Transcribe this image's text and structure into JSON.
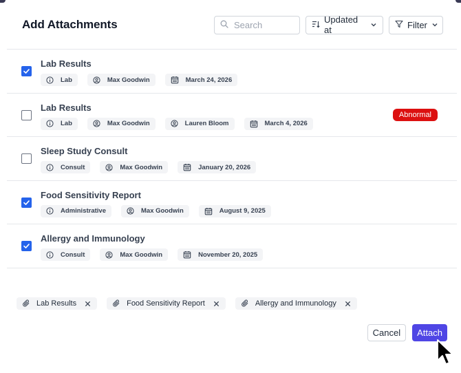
{
  "dialog": {
    "title": "Add Attachments"
  },
  "toolbar": {
    "search_placeholder": "Search",
    "sort_label": "Updated at",
    "filter_label": "Filter"
  },
  "rows": [
    {
      "title": "Lab Results",
      "checked": true,
      "type": "Lab",
      "people": [
        "Max Goodwin"
      ],
      "date": "March 24, 2026",
      "badge": ""
    },
    {
      "title": "Lab Results",
      "checked": false,
      "type": "Lab",
      "people": [
        "Max Goodwin",
        "Lauren Bloom"
      ],
      "date": "March 4, 2026",
      "badge": "Abnormal"
    },
    {
      "title": "Sleep Study Consult",
      "checked": false,
      "type": "Consult",
      "people": [
        "Max Goodwin"
      ],
      "date": "January 20, 2026",
      "badge": ""
    },
    {
      "title": "Food Sensitivity Report",
      "checked": true,
      "type": "Administrative",
      "people": [
        "Max Goodwin"
      ],
      "date": "August 9, 2025",
      "badge": ""
    },
    {
      "title": "Allergy and Immunology",
      "checked": true,
      "type": "Consult",
      "people": [
        "Max Goodwin"
      ],
      "date": "November 20, 2025",
      "badge": ""
    }
  ],
  "selected": [
    "Lab Results",
    "Food Sensitivity Report",
    "Allergy and Immunology"
  ],
  "actions": {
    "cancel_label": "Cancel",
    "attach_label": "Attach"
  },
  "colors": {
    "accent": "#4f46e5",
    "checkbox": "#2563eb",
    "badge": "#dc1010"
  },
  "icons": {
    "info": "info-icon",
    "person": "user-icon",
    "date": "calendar-icon",
    "attachment": "paperclip-icon",
    "remove": "close-icon",
    "search": "search-icon",
    "sort": "sort-icon",
    "filter": "filter-icon"
  }
}
